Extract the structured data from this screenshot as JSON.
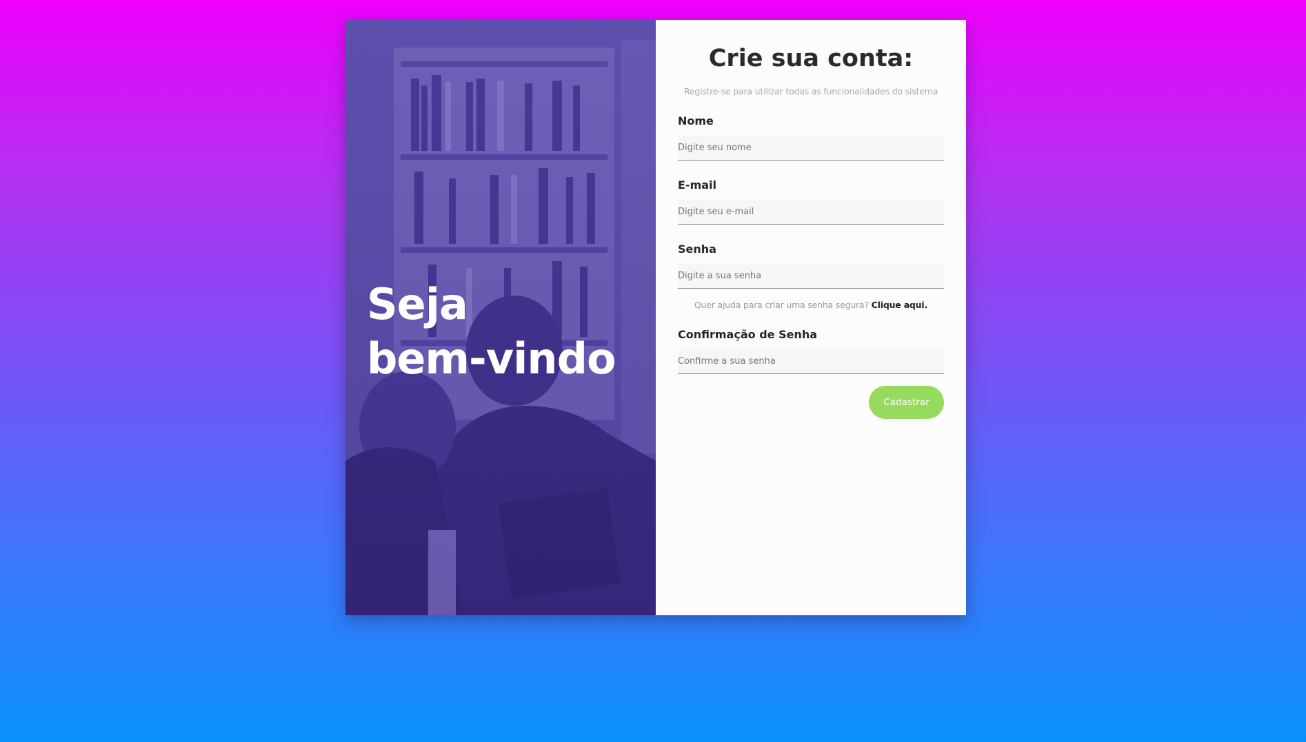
{
  "hero": {
    "title_line1": "Seja",
    "title_line2": "bem-vindo"
  },
  "form": {
    "title": "Crie sua conta:",
    "subtitle": "Registre-se para utilizar todas as funcionalidades do sistema",
    "name_label": "Nome",
    "name_placeholder": "Digite seu nome",
    "email_label": "E-mail",
    "email_placeholder": "Digite seu e-mail",
    "password_label": "Senha",
    "password_placeholder": "Digite a sua senha",
    "help_text": "Quer ajuda para criar uma senha segura? ",
    "help_link": "Clique aqui.",
    "confirm_label": "Confirmação de Senha",
    "confirm_placeholder": "Confirme a sua senha",
    "submit_label": "Cadastrar"
  },
  "colors": {
    "background_top": "#ee00fc",
    "background_bottom": "#0a8ffc",
    "hero_overlay": "#4f3fa8",
    "submit_button": "#96db5e"
  }
}
